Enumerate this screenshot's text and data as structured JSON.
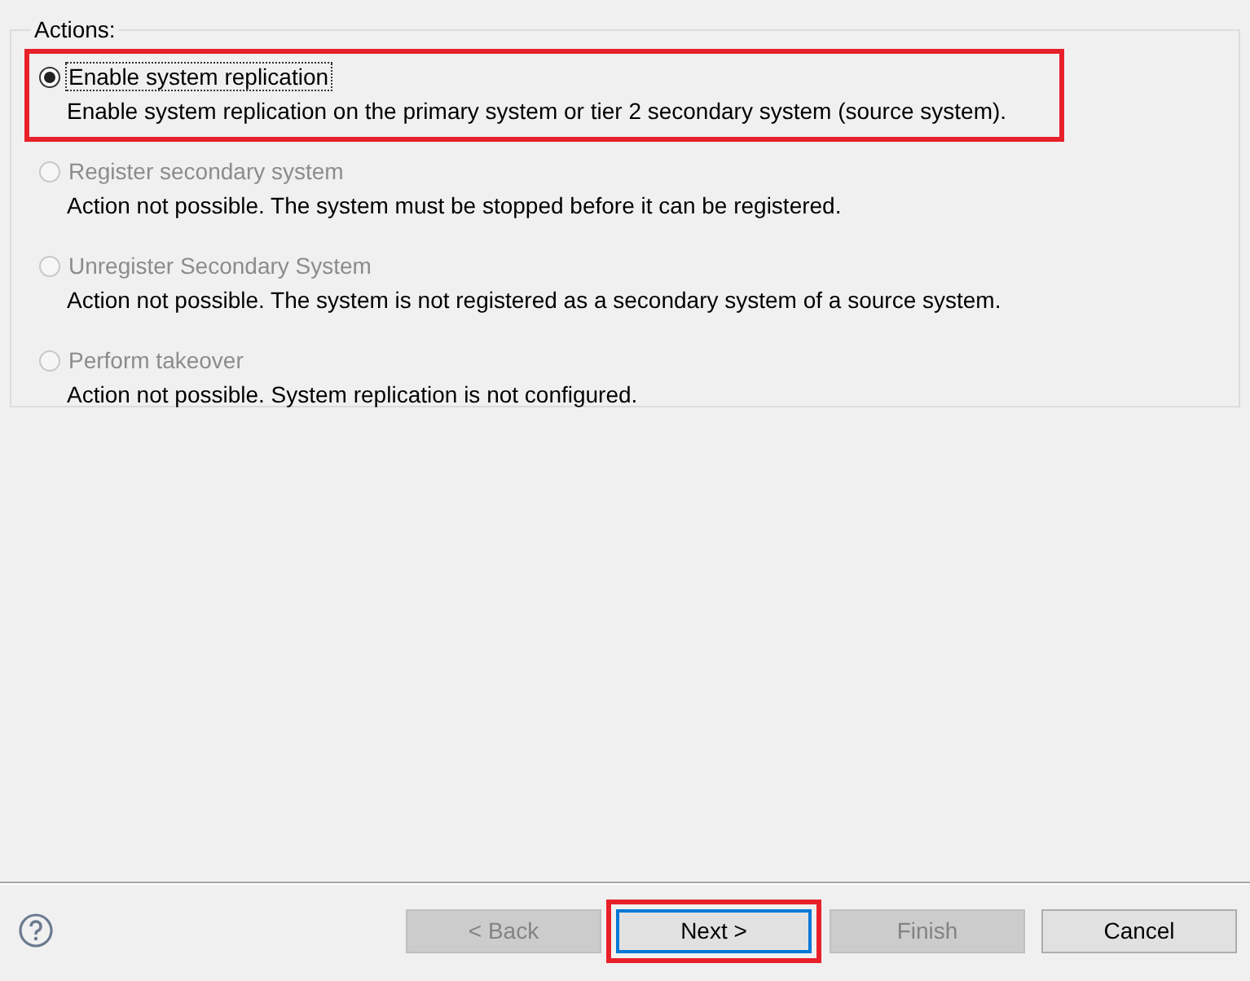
{
  "group": {
    "title": "Actions:"
  },
  "actions": [
    {
      "label": "Enable system replication",
      "description": "Enable system replication on the primary system or tier 2 secondary system (source system).",
      "selected": true,
      "disabled": false,
      "highlighted": true
    },
    {
      "label": "Register secondary system",
      "description": "Action not possible. The system must be stopped before it can be registered.",
      "selected": false,
      "disabled": true,
      "highlighted": false
    },
    {
      "label": "Unregister Secondary System",
      "description": "Action not possible. The system is not registered as a secondary system of a source system.",
      "selected": false,
      "disabled": true,
      "highlighted": false
    },
    {
      "label": "Perform takeover",
      "description": "Action not possible. System replication is not configured.",
      "selected": false,
      "disabled": true,
      "highlighted": false
    }
  ],
  "buttons": [
    {
      "label": "< Back",
      "disabled": true,
      "highlighted": false
    },
    {
      "label": "Next >",
      "disabled": false,
      "highlighted": true
    },
    {
      "label": "Finish",
      "disabled": true,
      "highlighted": false
    },
    {
      "label": "Cancel",
      "disabled": false,
      "highlighted": false
    }
  ]
}
